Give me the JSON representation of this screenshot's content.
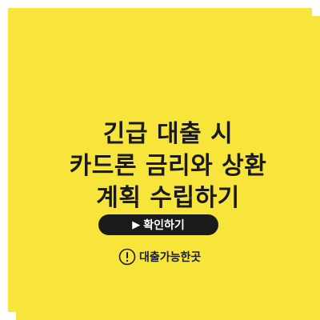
{
  "colors": {
    "background": "#f7e53b",
    "border": "#ffffff",
    "text": "#1a1a1a",
    "button_background": "#1a1a1a",
    "button_text": "#ffffff"
  },
  "headline": {
    "lines": [
      "긴급 대출 시",
      "카드론 금리와 상환",
      "계획 수립하기"
    ]
  },
  "cta_button": {
    "label": "확인하기",
    "icon": "play-triangle-icon"
  },
  "brand": {
    "icon": "exclamation-circle-icon",
    "name": "대출가능한곳"
  }
}
